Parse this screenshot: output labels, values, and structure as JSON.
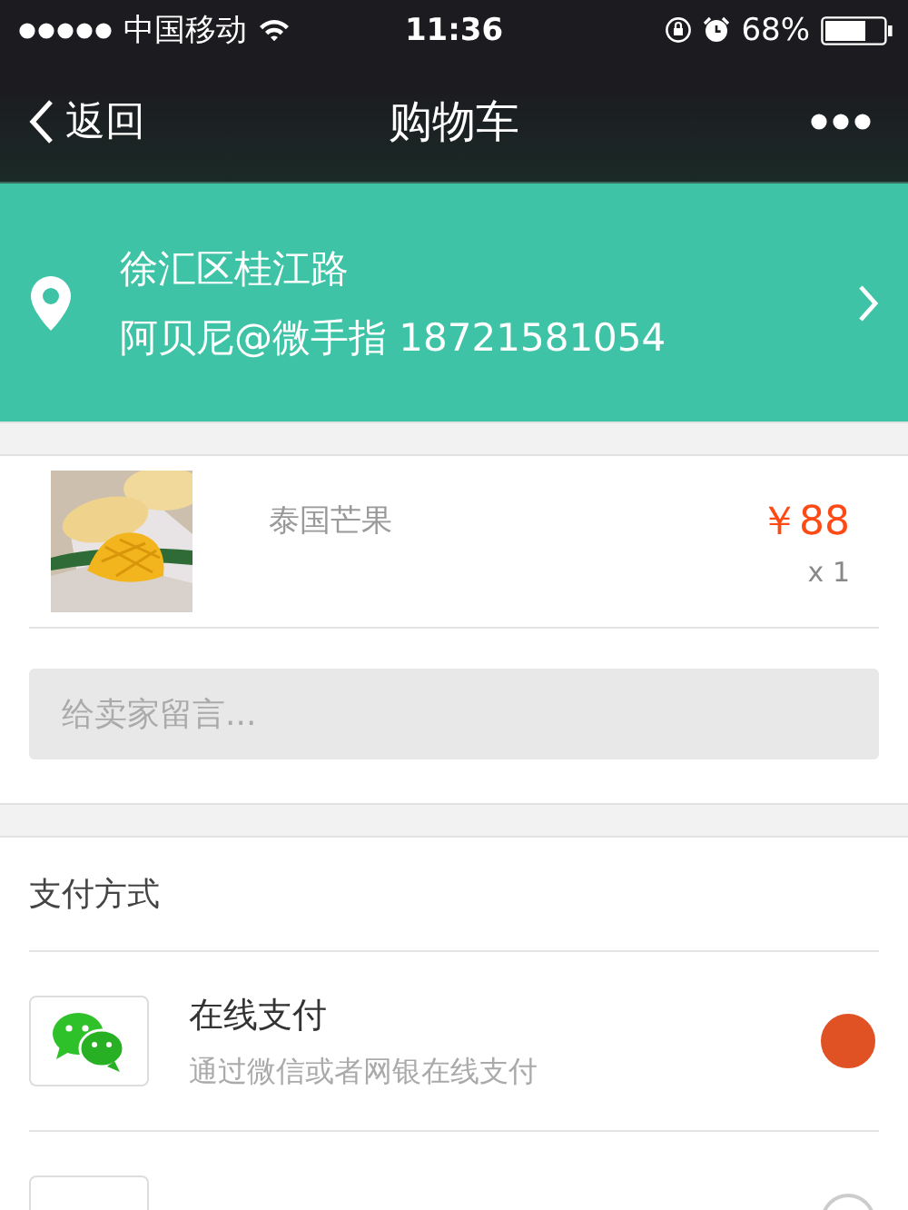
{
  "status_bar": {
    "carrier": "中国移动",
    "time": "11:36",
    "battery": "68%"
  },
  "nav": {
    "back": "返回",
    "title": "购物车"
  },
  "address": {
    "line1": "徐汇区桂江路",
    "line2": "阿贝尼@微手指 18721581054"
  },
  "product": {
    "name": "泰国芒果",
    "price": "￥88",
    "quantity": "x 1"
  },
  "message": {
    "placeholder": "给卖家留言..."
  },
  "payment": {
    "heading": "支付方式",
    "methods": [
      {
        "title": "在线支付",
        "subtitle": "通过微信或者网银在线支付",
        "selected": true
      },
      {
        "selected": false
      }
    ]
  }
}
